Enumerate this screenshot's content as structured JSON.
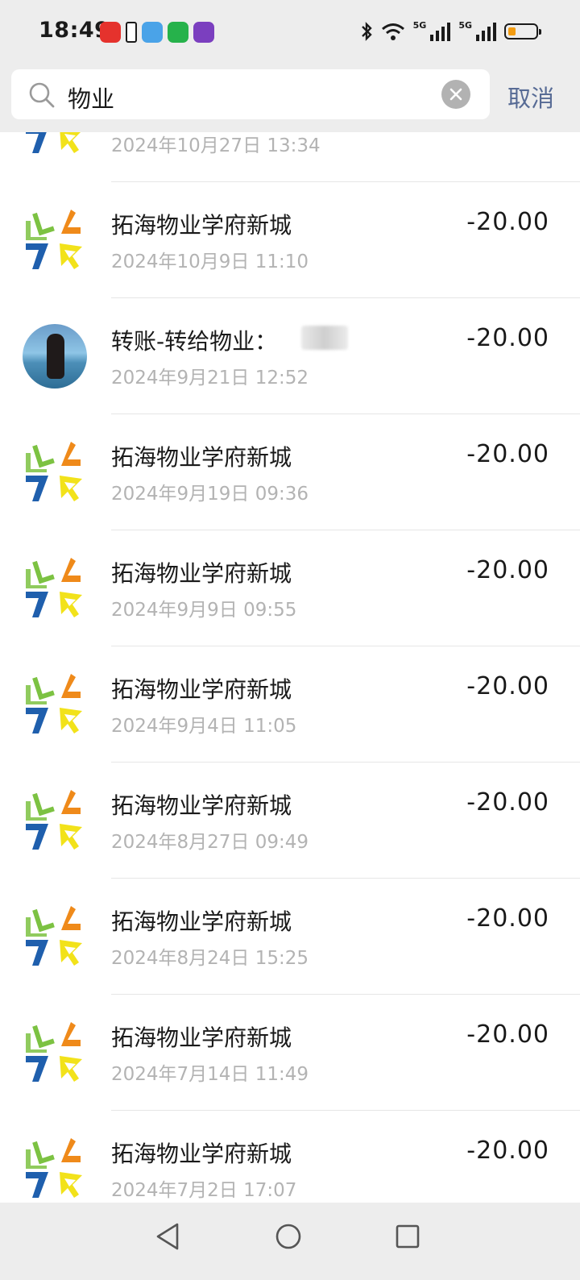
{
  "status_bar": {
    "time": "18:49",
    "network_1": "5G",
    "network_2": "5G",
    "battery_level": 0.3,
    "icons": [
      "video-app-icon",
      "battery-saver-icon",
      "weather-app-icon",
      "video-play-app-icon",
      "game-app-icon",
      "bluetooth-icon",
      "wifi-icon",
      "signal-icon",
      "signal-icon",
      "battery-icon"
    ]
  },
  "search": {
    "query": "物业",
    "cancel_label": "取消"
  },
  "transactions": [
    {
      "title": "",
      "date": "2024年10月27日 13:34",
      "amount": "",
      "avatar": "logo"
    },
    {
      "title": "拓海物业学府新城",
      "date": "2024年10月9日 11:10",
      "amount": "-20.00",
      "avatar": "logo"
    },
    {
      "title": "转账-转给物业：",
      "date": "2024年9月21日 12:52",
      "amount": "-20.00",
      "avatar": "photo"
    },
    {
      "title": "拓海物业学府新城",
      "date": "2024年9月19日 09:36",
      "amount": "-20.00",
      "avatar": "logo"
    },
    {
      "title": "拓海物业学府新城",
      "date": "2024年9月9日 09:55",
      "amount": "-20.00",
      "avatar": "logo"
    },
    {
      "title": "拓海物业学府新城",
      "date": "2024年9月4日 11:05",
      "amount": "-20.00",
      "avatar": "logo"
    },
    {
      "title": "拓海物业学府新城",
      "date": "2024年8月27日 09:49",
      "amount": "-20.00",
      "avatar": "logo"
    },
    {
      "title": "拓海物业学府新城",
      "date": "2024年8月24日 15:25",
      "amount": "-20.00",
      "avatar": "logo"
    },
    {
      "title": "拓海物业学府新城",
      "date": "2024年7月14日 11:49",
      "amount": "-20.00",
      "avatar": "logo"
    },
    {
      "title": "拓海物业学府新城",
      "date": "2024年7月2日 17:07",
      "amount": "-20.00",
      "avatar": "logo"
    }
  ],
  "colors": {
    "logo_green": "#7cc242",
    "logo_orange": "#ef8a1a",
    "logo_blue": "#1f5fad",
    "logo_yellow": "#f2e21a",
    "link_blue": "#576b95",
    "date_gray": "#b3b3b3"
  },
  "nav_bar": {
    "icons": [
      "back-icon",
      "home-icon",
      "recents-icon"
    ]
  }
}
